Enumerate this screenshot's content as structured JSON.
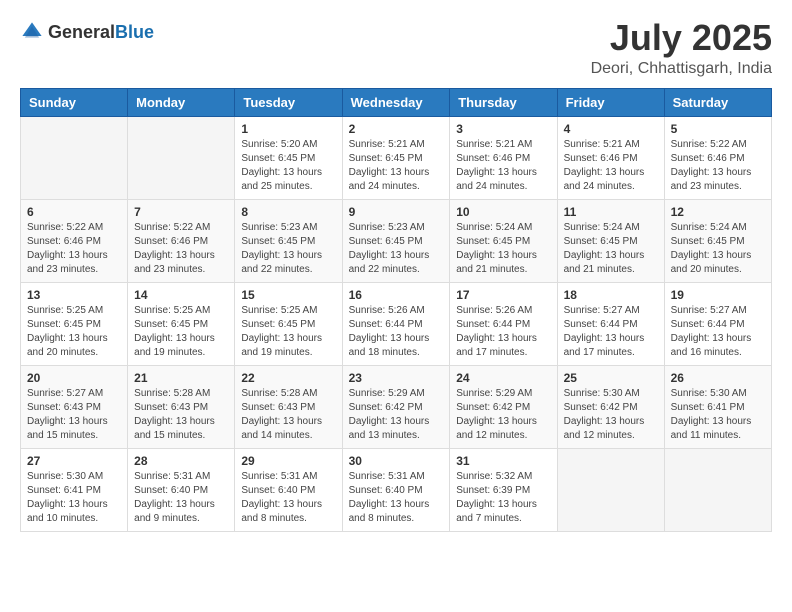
{
  "header": {
    "logo_general": "General",
    "logo_blue": "Blue",
    "month_year": "July 2025",
    "location": "Deori, Chhattisgarh, India"
  },
  "days_of_week": [
    "Sunday",
    "Monday",
    "Tuesday",
    "Wednesday",
    "Thursday",
    "Friday",
    "Saturday"
  ],
  "weeks": [
    [
      {
        "day": "",
        "info": ""
      },
      {
        "day": "",
        "info": ""
      },
      {
        "day": "1",
        "sunrise": "5:20 AM",
        "sunset": "6:45 PM",
        "daylight": "13 hours and 25 minutes."
      },
      {
        "day": "2",
        "sunrise": "5:21 AM",
        "sunset": "6:45 PM",
        "daylight": "13 hours and 24 minutes."
      },
      {
        "day": "3",
        "sunrise": "5:21 AM",
        "sunset": "6:46 PM",
        "daylight": "13 hours and 24 minutes."
      },
      {
        "day": "4",
        "sunrise": "5:21 AM",
        "sunset": "6:46 PM",
        "daylight": "13 hours and 24 minutes."
      },
      {
        "day": "5",
        "sunrise": "5:22 AM",
        "sunset": "6:46 PM",
        "daylight": "13 hours and 23 minutes."
      }
    ],
    [
      {
        "day": "6",
        "sunrise": "5:22 AM",
        "sunset": "6:46 PM",
        "daylight": "13 hours and 23 minutes."
      },
      {
        "day": "7",
        "sunrise": "5:22 AM",
        "sunset": "6:46 PM",
        "daylight": "13 hours and 23 minutes."
      },
      {
        "day": "8",
        "sunrise": "5:23 AM",
        "sunset": "6:45 PM",
        "daylight": "13 hours and 22 minutes."
      },
      {
        "day": "9",
        "sunrise": "5:23 AM",
        "sunset": "6:45 PM",
        "daylight": "13 hours and 22 minutes."
      },
      {
        "day": "10",
        "sunrise": "5:24 AM",
        "sunset": "6:45 PM",
        "daylight": "13 hours and 21 minutes."
      },
      {
        "day": "11",
        "sunrise": "5:24 AM",
        "sunset": "6:45 PM",
        "daylight": "13 hours and 21 minutes."
      },
      {
        "day": "12",
        "sunrise": "5:24 AM",
        "sunset": "6:45 PM",
        "daylight": "13 hours and 20 minutes."
      }
    ],
    [
      {
        "day": "13",
        "sunrise": "5:25 AM",
        "sunset": "6:45 PM",
        "daylight": "13 hours and 20 minutes."
      },
      {
        "day": "14",
        "sunrise": "5:25 AM",
        "sunset": "6:45 PM",
        "daylight": "13 hours and 19 minutes."
      },
      {
        "day": "15",
        "sunrise": "5:25 AM",
        "sunset": "6:45 PM",
        "daylight": "13 hours and 19 minutes."
      },
      {
        "day": "16",
        "sunrise": "5:26 AM",
        "sunset": "6:44 PM",
        "daylight": "13 hours and 18 minutes."
      },
      {
        "day": "17",
        "sunrise": "5:26 AM",
        "sunset": "6:44 PM",
        "daylight": "13 hours and 17 minutes."
      },
      {
        "day": "18",
        "sunrise": "5:27 AM",
        "sunset": "6:44 PM",
        "daylight": "13 hours and 17 minutes."
      },
      {
        "day": "19",
        "sunrise": "5:27 AM",
        "sunset": "6:44 PM",
        "daylight": "13 hours and 16 minutes."
      }
    ],
    [
      {
        "day": "20",
        "sunrise": "5:27 AM",
        "sunset": "6:43 PM",
        "daylight": "13 hours and 15 minutes."
      },
      {
        "day": "21",
        "sunrise": "5:28 AM",
        "sunset": "6:43 PM",
        "daylight": "13 hours and 15 minutes."
      },
      {
        "day": "22",
        "sunrise": "5:28 AM",
        "sunset": "6:43 PM",
        "daylight": "13 hours and 14 minutes."
      },
      {
        "day": "23",
        "sunrise": "5:29 AM",
        "sunset": "6:42 PM",
        "daylight": "13 hours and 13 minutes."
      },
      {
        "day": "24",
        "sunrise": "5:29 AM",
        "sunset": "6:42 PM",
        "daylight": "13 hours and 12 minutes."
      },
      {
        "day": "25",
        "sunrise": "5:30 AM",
        "sunset": "6:42 PM",
        "daylight": "13 hours and 12 minutes."
      },
      {
        "day": "26",
        "sunrise": "5:30 AM",
        "sunset": "6:41 PM",
        "daylight": "13 hours and 11 minutes."
      }
    ],
    [
      {
        "day": "27",
        "sunrise": "5:30 AM",
        "sunset": "6:41 PM",
        "daylight": "13 hours and 10 minutes."
      },
      {
        "day": "28",
        "sunrise": "5:31 AM",
        "sunset": "6:40 PM",
        "daylight": "13 hours and 9 minutes."
      },
      {
        "day": "29",
        "sunrise": "5:31 AM",
        "sunset": "6:40 PM",
        "daylight": "13 hours and 8 minutes."
      },
      {
        "day": "30",
        "sunrise": "5:31 AM",
        "sunset": "6:40 PM",
        "daylight": "13 hours and 8 minutes."
      },
      {
        "day": "31",
        "sunrise": "5:32 AM",
        "sunset": "6:39 PM",
        "daylight": "13 hours and 7 minutes."
      },
      {
        "day": "",
        "info": ""
      },
      {
        "day": "",
        "info": ""
      }
    ]
  ],
  "labels": {
    "sunrise": "Sunrise:",
    "sunset": "Sunset:",
    "daylight": "Daylight:"
  }
}
